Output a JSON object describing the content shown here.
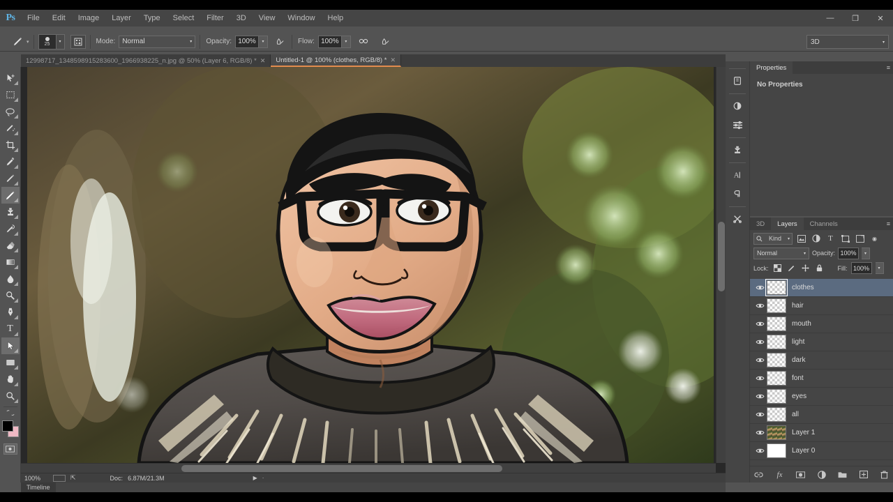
{
  "app": {
    "name": "Adobe Photoshop",
    "logo_text": "Ps"
  },
  "menubar": {
    "items": [
      "File",
      "Edit",
      "Image",
      "Layer",
      "Type",
      "Select",
      "Filter",
      "3D",
      "View",
      "Window",
      "Help"
    ],
    "window_controls": {
      "minimize": "—",
      "restore": "❐",
      "close": "✕"
    }
  },
  "options_bar": {
    "tool_icon": "brush-tool",
    "brush_size": "25",
    "mode_label": "Mode:",
    "mode_value": "Normal",
    "opacity_label": "Opacity:",
    "opacity_value": "100%",
    "flow_label": "Flow:",
    "flow_value": "100%",
    "airbrush_icon": "airbrush-icon",
    "tablet_pressure_size_icon": "pressure-size-icon",
    "tablet_pressure_opacity_icon": "pressure-opacity-icon",
    "workspace": "3D"
  },
  "document_tabs": [
    {
      "label": "12998717_1348598915283600_1966938225_n.jpg @ 50% (Layer 6, RGB/8) *",
      "active": false,
      "close": "✕"
    },
    {
      "label": "Untitled-1 @ 100% (clothes, RGB/8) *",
      "active": true,
      "close": "✕"
    }
  ],
  "toolbar": {
    "tools": [
      {
        "name": "move-tool",
        "glyph": "move"
      },
      {
        "name": "rectangular-marquee-tool",
        "glyph": "marquee"
      },
      {
        "name": "lasso-tool",
        "glyph": "lasso"
      },
      {
        "name": "quick-selection-tool",
        "glyph": "quickselect"
      },
      {
        "name": "crop-tool",
        "glyph": "crop"
      },
      {
        "name": "eyedropper-tool",
        "glyph": "eyedropper"
      },
      {
        "name": "spot-healing-brush-tool",
        "glyph": "healing"
      },
      {
        "name": "brush-tool",
        "glyph": "brush",
        "active": true
      },
      {
        "name": "clone-stamp-tool",
        "glyph": "stamp"
      },
      {
        "name": "history-brush-tool",
        "glyph": "historybrush"
      },
      {
        "name": "eraser-tool",
        "glyph": "eraser"
      },
      {
        "name": "gradient-tool",
        "glyph": "gradient"
      },
      {
        "name": "blur-tool",
        "glyph": "blur"
      },
      {
        "name": "dodge-tool",
        "glyph": "dodge"
      },
      {
        "name": "pen-tool",
        "glyph": "pen"
      },
      {
        "name": "horizontal-type-tool",
        "glyph": "type"
      },
      {
        "name": "path-selection-tool",
        "glyph": "pathselect",
        "active": true
      },
      {
        "name": "rectangle-tool",
        "glyph": "shape"
      },
      {
        "name": "hand-tool",
        "glyph": "hand"
      },
      {
        "name": "zoom-tool",
        "glyph": "zoom"
      }
    ],
    "foreground_color": "#000000",
    "background_color": "#f0b9c4",
    "quick_mask_name": "quick-mask-toggle"
  },
  "canvas": {
    "artwork_title": "cartoon-vector-portrait-of-man-with-glasses",
    "background_scroll": true
  },
  "status_bar": {
    "zoom": "100%",
    "doc_label": "Doc:",
    "doc_value": "6.87M/21.3M"
  },
  "timeline": {
    "tab_label": "Timeline"
  },
  "right_rail": {
    "icons": [
      {
        "name": "properties-panel-icon",
        "glyph": "◫"
      },
      {
        "name": "adjustments-panel-icon",
        "glyph": "◑"
      },
      {
        "name": "styles-panel-icon",
        "glyph": "≡"
      },
      {
        "name": "clone-source-panel-icon",
        "glyph": "⌼"
      },
      {
        "name": "character-panel-icon",
        "glyph": "A"
      },
      {
        "name": "paragraph-panel-icon",
        "glyph": "¶"
      },
      {
        "name": "color-mixer-panel-icon",
        "glyph": "✂"
      }
    ]
  },
  "properties_panel": {
    "tabs": [
      {
        "label": "Properties",
        "active": true
      }
    ],
    "empty_message": "No Properties",
    "menu_glyph": "≡"
  },
  "layers_panel": {
    "tabs": [
      {
        "label": "3D",
        "active": false
      },
      {
        "label": "Layers",
        "active": true
      },
      {
        "label": "Channels",
        "active": false
      }
    ],
    "menu_glyph": "≡",
    "filter": {
      "kind_label": "Kind",
      "search_icon": "search-icon",
      "type_filters": [
        {
          "name": "filter-pixel-layers-icon",
          "glyph": "▣"
        },
        {
          "name": "filter-adjustment-layers-icon",
          "glyph": "◐"
        },
        {
          "name": "filter-type-layers-icon",
          "glyph": "T"
        },
        {
          "name": "filter-shape-layers-icon",
          "glyph": "⬚"
        },
        {
          "name": "filter-smart-objects-icon",
          "glyph": "⧉"
        }
      ],
      "toggle_glyph": "◉"
    },
    "blend_mode": "Normal",
    "opacity_label": "Opacity:",
    "opacity_value": "100%",
    "lock_label": "Lock:",
    "lock_icons": [
      {
        "name": "lock-transparent-pixels-icon",
        "glyph": "▨"
      },
      {
        "name": "lock-image-pixels-icon",
        "glyph": "✎"
      },
      {
        "name": "lock-position-icon",
        "glyph": "✛"
      },
      {
        "name": "lock-all-icon",
        "glyph": "🔒"
      }
    ],
    "fill_label": "Fill:",
    "fill_value": "100%",
    "layers": [
      {
        "name": "clothes",
        "visible": true,
        "selected": true,
        "thumb": "transparent"
      },
      {
        "name": "hair",
        "visible": true,
        "selected": false,
        "thumb": "transparent"
      },
      {
        "name": "mouth",
        "visible": true,
        "selected": false,
        "thumb": "transparent"
      },
      {
        "name": "light",
        "visible": true,
        "selected": false,
        "thumb": "transparent"
      },
      {
        "name": "dark",
        "visible": true,
        "selected": false,
        "thumb": "transparent"
      },
      {
        "name": "font",
        "visible": true,
        "selected": false,
        "thumb": "transparent"
      },
      {
        "name": "eyes",
        "visible": true,
        "selected": false,
        "thumb": "transparent"
      },
      {
        "name": "all",
        "visible": true,
        "selected": false,
        "thumb": "transparent"
      },
      {
        "name": "Layer 1",
        "visible": true,
        "selected": false,
        "thumb": "photo"
      },
      {
        "name": "Layer 0",
        "visible": true,
        "selected": false,
        "thumb": "white"
      }
    ],
    "eye_glyph": "👁",
    "footer_buttons": [
      {
        "name": "link-layers-button",
        "glyph": "⛓"
      },
      {
        "name": "add-layer-style-button",
        "glyph": "fx"
      },
      {
        "name": "add-layer-mask-button",
        "glyph": "▣"
      },
      {
        "name": "new-fill-adjustment-layer-button",
        "glyph": "◑"
      },
      {
        "name": "new-group-button",
        "glyph": "🗀"
      },
      {
        "name": "new-layer-button",
        "glyph": "❏"
      },
      {
        "name": "delete-layer-button",
        "glyph": "🗑"
      }
    ]
  },
  "colors": {
    "chrome": "#535353",
    "panel": "#454545",
    "selection_blue": "#5b6b80",
    "accent_orange": "#e28b4e",
    "logo_blue": "#5fb4e5"
  }
}
